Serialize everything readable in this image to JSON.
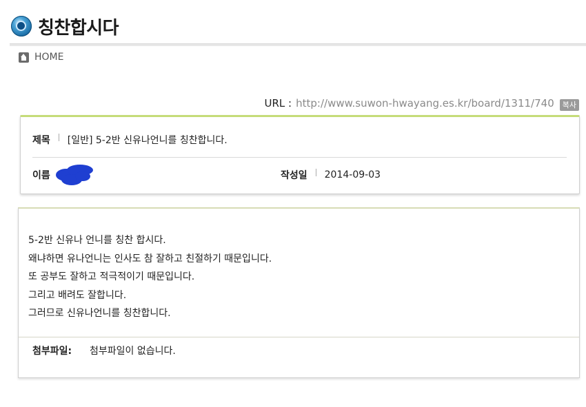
{
  "header": {
    "title": "칭찬합시다"
  },
  "breadcrumb": {
    "home_label": "HOME"
  },
  "url_bar": {
    "label": "URL :",
    "value": "http://www.suwon-hwayang.es.kr/board/1311/740",
    "copy_label": "복사"
  },
  "post": {
    "subject_label": "제목",
    "subject": "[일반] 5-2반 신유나언니를 칭찬합니다.",
    "name_label": "이름",
    "date_label": "작성일",
    "date": "2014-09-03",
    "body": [
      "5-2반 신유나 언니를 칭찬 합시다.",
      "왜냐하면 유나언니는 인사도 참 잘하고 친절하기  때문입니다.",
      "또 공부도 잘하고 적극적이기 때문입니다.",
      "그리고 배려도 잘합니다.",
      "그러므로 신유나언니를 칭찬합니다."
    ],
    "attachment_label": "첨부파일:",
    "attachment_value": "첨부파일이 없습니다."
  },
  "colors": {
    "accent_top_border": "#c5dc78",
    "redaction": "#1f3fd1",
    "title_icon": "#1d6fa8"
  }
}
